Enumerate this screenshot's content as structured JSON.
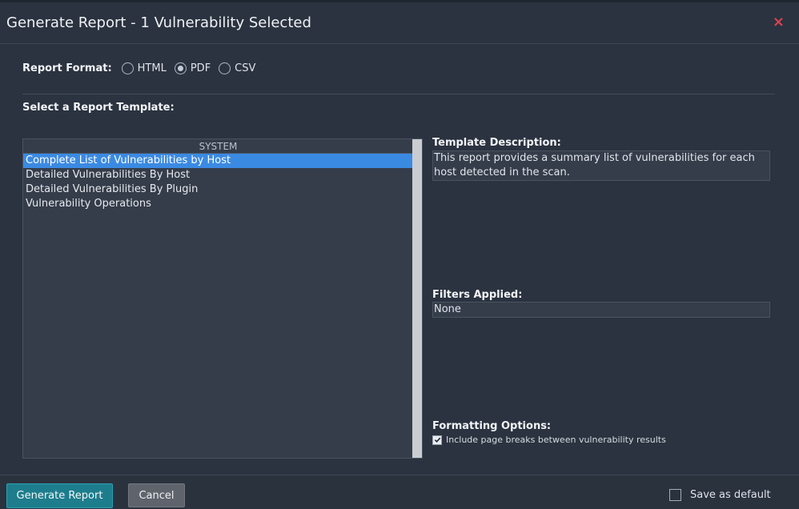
{
  "dialog": {
    "title": "Generate Report - 1 Vulnerability Selected",
    "close_symbol": "×"
  },
  "report_format": {
    "label": "Report Format:",
    "options": [
      {
        "label": "HTML",
        "checked": false
      },
      {
        "label": "PDF",
        "checked": true
      },
      {
        "label": "CSV",
        "checked": false
      }
    ]
  },
  "template_section": {
    "label": "Select a Report Template:",
    "list_header": "SYSTEM",
    "items": [
      {
        "label": "Complete List of Vulnerabilities by Host",
        "selected": true
      },
      {
        "label": "Detailed Vulnerabilities By Host",
        "selected": false
      },
      {
        "label": "Detailed Vulnerabilities By Plugin",
        "selected": false
      },
      {
        "label": "Vulnerability Operations",
        "selected": false
      }
    ]
  },
  "description": {
    "label": "Template Description:",
    "text": "This report provides a summary list of vulnerabilities for each host detected in the scan."
  },
  "filters": {
    "label": "Filters Applied:",
    "value": "None"
  },
  "formatting": {
    "label": "Formatting Options:",
    "page_breaks_label": "Include page breaks between vulnerability results",
    "page_breaks_checked": true
  },
  "footer": {
    "generate_label": "Generate Report",
    "cancel_label": "Cancel",
    "save_default_label": "Save as default"
  },
  "colors": {
    "accent_selection": "#3b8ae2",
    "primary_button": "#1d7d8c",
    "close_icon": "#e2404f"
  }
}
